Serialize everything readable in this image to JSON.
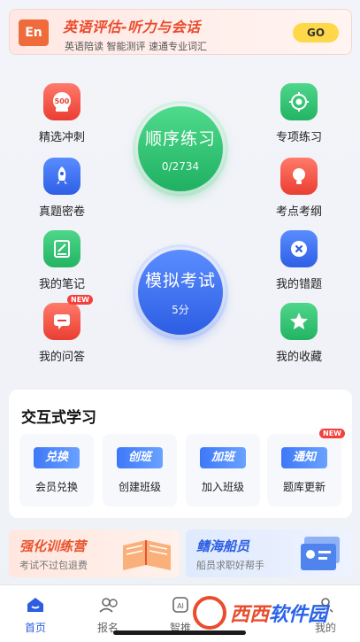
{
  "banner": {
    "logo": "En",
    "title": "英语评估-听力与会话",
    "subtitle": "英语陪读 智能测评 速通专业词汇",
    "go_label": "GO"
  },
  "left_items": [
    {
      "label": "精选冲刺",
      "icon": "500-badge-icon",
      "color": "red"
    },
    {
      "label": "真题密卷",
      "icon": "rocket-icon",
      "color": "blue"
    },
    {
      "label": "我的笔记",
      "icon": "notebook-icon",
      "color": "green"
    },
    {
      "label": "我的问答",
      "icon": "chat-icon",
      "color": "red",
      "badge": "NEW"
    }
  ],
  "right_items": [
    {
      "label": "专项练习",
      "icon": "target-icon",
      "color": "green"
    },
    {
      "label": "考点考纲",
      "icon": "lightbulb-icon",
      "color": "red"
    },
    {
      "label": "我的错题",
      "icon": "x-circle-icon",
      "color": "blue"
    },
    {
      "label": "我的收藏",
      "icon": "star-icon",
      "color": "green"
    }
  ],
  "sequential": {
    "title": "顺序练习",
    "progress": "0/2734"
  },
  "mock_exam": {
    "title": "模拟考试",
    "duration": "5分"
  },
  "interactive": {
    "title": "交互式学习",
    "items": [
      {
        "icon_text": "兑换",
        "label": "会员兑换"
      },
      {
        "icon_text": "创班",
        "label": "创建班级"
      },
      {
        "icon_text": "加班",
        "label": "加入班级"
      },
      {
        "icon_text": "通知",
        "label": "题库更新",
        "badge": "NEW"
      }
    ]
  },
  "promos": [
    {
      "title": "强化训练营",
      "subtitle": "考试不过包退费"
    },
    {
      "title": "鳍海船员",
      "subtitle": "船员求职好帮手"
    }
  ],
  "nav": [
    {
      "label": "首页",
      "active": true
    },
    {
      "label": "报名",
      "active": false
    },
    {
      "label": "智推",
      "active": false
    },
    {
      "label": "我的",
      "active": false
    }
  ],
  "watermark": {
    "part1": "西西",
    "part2": "软件园"
  },
  "colors": {
    "accent_blue": "#2e5fe6",
    "accent_green": "#22b463",
    "accent_red": "#ea3e32"
  }
}
